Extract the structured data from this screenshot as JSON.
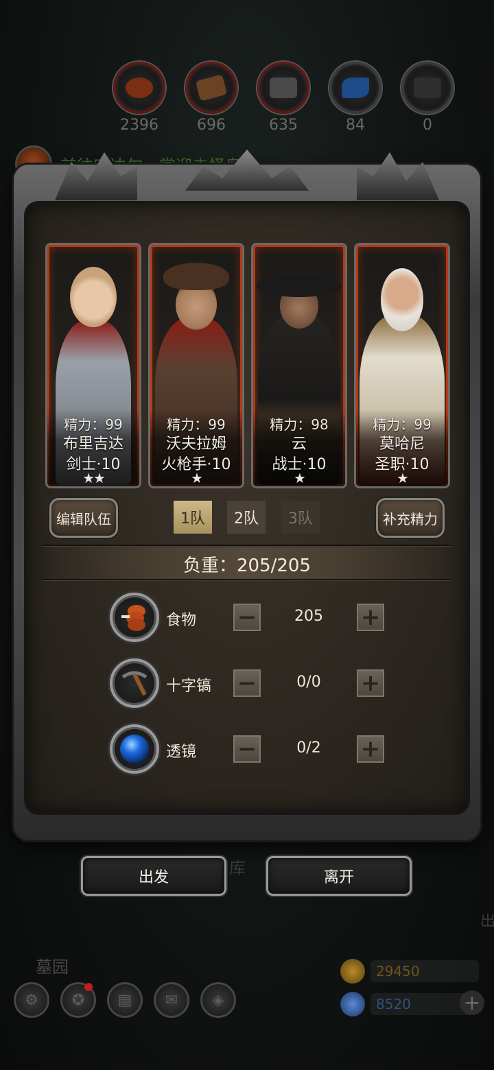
{
  "resources": [
    {
      "icon": "meat-icon",
      "value": "2396",
      "color": "#b34a1c",
      "ring": "red"
    },
    {
      "icon": "wood-icon",
      "value": "696",
      "color": "#8a5a2a",
      "ring": "red"
    },
    {
      "icon": "iron-icon",
      "value": "635",
      "color": "#5a5a5a",
      "ring": "red"
    },
    {
      "icon": "crystal-icon",
      "value": "84",
      "color": "#2a6ab4",
      "ring": "grey"
    },
    {
      "icon": "ingot-icon",
      "value": "0",
      "color": "#3a3a3a",
      "ring": "grey"
    }
  ],
  "quest": {
    "text": "前往安达尔…赏迎击怪鸟"
  },
  "background": {
    "warehouse": "仓库",
    "exit": "出",
    "cemetery": "墓园"
  },
  "currency": {
    "gold": "29450",
    "gem": "8520"
  },
  "heroes": [
    {
      "stamina": "精力：99",
      "name": "布里吉达",
      "class": "剑士·10",
      "stars": "★★",
      "hair": "#c7a27a",
      "body": "#9a9ea4",
      "accent": "#a01c1c"
    },
    {
      "stamina": "精力：99",
      "name": "沃夫拉姆",
      "class": "火枪手·10",
      "stars": "★",
      "hair": "#4a3020",
      "body": "#5a4030",
      "accent": "#8a1c14"
    },
    {
      "stamina": "精力：98",
      "name": "云",
      "class": "战士·10",
      "stars": "★",
      "hair": "#1a1a1a",
      "body": "#2a2826",
      "accent": "#5a4630"
    },
    {
      "stamina": "精力：99",
      "name": "莫哈尼",
      "class": "圣职·10",
      "stars": "★",
      "hair": "#d8d4cc",
      "body": "#d9d1c0",
      "accent": "#6a2a1a"
    }
  ],
  "buttons": {
    "edit_team": "编辑队伍",
    "refill": "补充精力",
    "depart": "出发",
    "leave": "离开"
  },
  "tabs": [
    "1队",
    "2队",
    "3队"
  ],
  "active_tab": 0,
  "load": {
    "text": "负重：205/205"
  },
  "supplies": [
    {
      "icon": "food-icon",
      "label": "食物",
      "value": "205"
    },
    {
      "icon": "pickaxe-icon",
      "label": "十字镐",
      "value": "0/0"
    },
    {
      "icon": "lens-icon",
      "label": "透镜",
      "value": "0/2"
    }
  ],
  "controls": {
    "minus": "−",
    "plus": "+"
  }
}
